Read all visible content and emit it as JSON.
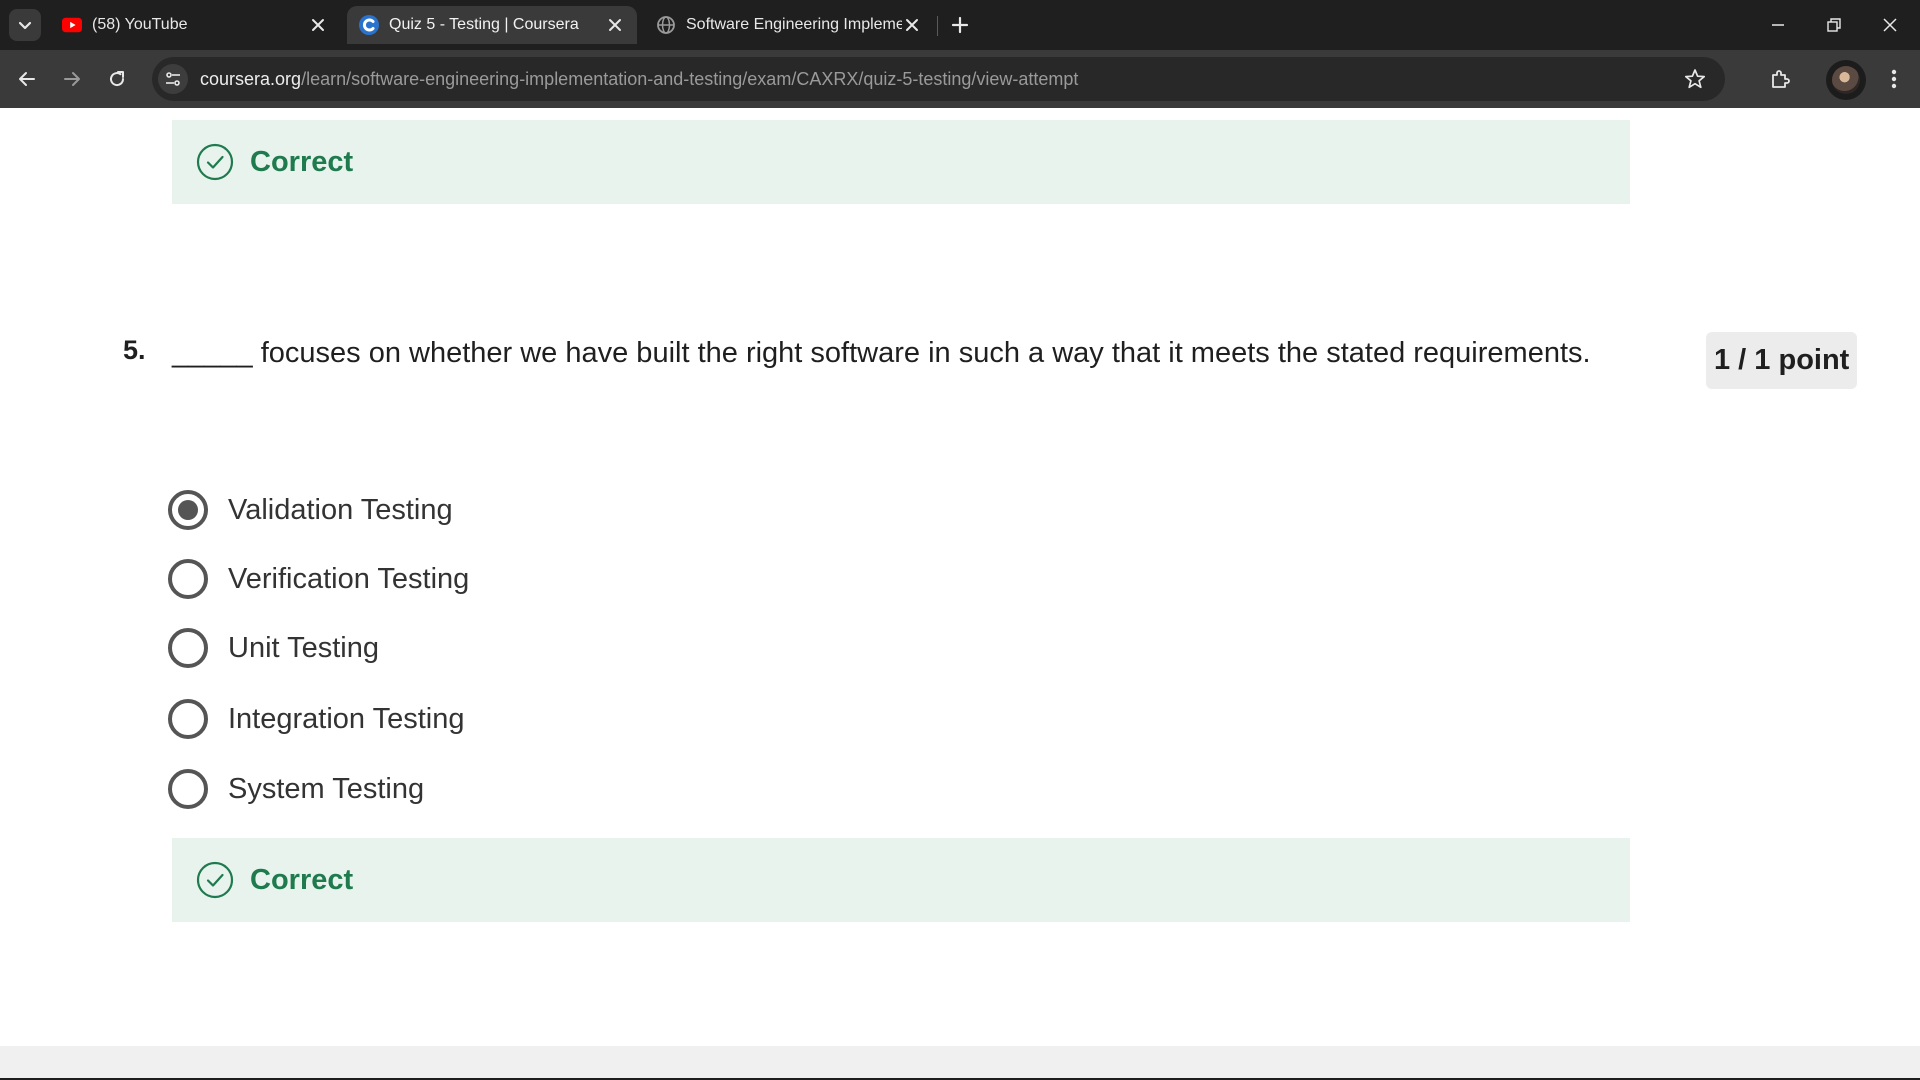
{
  "browser": {
    "tabs": [
      {
        "title": "(58) YouTube",
        "icon": "youtube-icon"
      },
      {
        "title": "Quiz 5 - Testing | Coursera",
        "icon": "coursera-icon"
      },
      {
        "title": "Software Engineering Implemen",
        "icon": "globe-icon"
      }
    ],
    "url_host": "coursera.org",
    "url_path": "/learn/software-engineering-implementation-and-testing/exam/CAXRX/quiz-5-testing/view-attempt"
  },
  "feedback_prev": {
    "label": "Correct"
  },
  "question": {
    "number": "5.",
    "text": "_____ focuses on whether we have built the right software in such a way that it meets the stated requirements.",
    "points": "1 / 1 point",
    "options": [
      {
        "label": "Validation Testing",
        "selected": true
      },
      {
        "label": "Verification Testing",
        "selected": false
      },
      {
        "label": "Unit Testing",
        "selected": false
      },
      {
        "label": "Integration Testing",
        "selected": false
      },
      {
        "label": "System Testing",
        "selected": false
      }
    ],
    "feedback": {
      "label": "Correct"
    }
  },
  "colors": {
    "correct_green": "#1f7a4d",
    "feedback_bg": "#e8f3ee"
  }
}
